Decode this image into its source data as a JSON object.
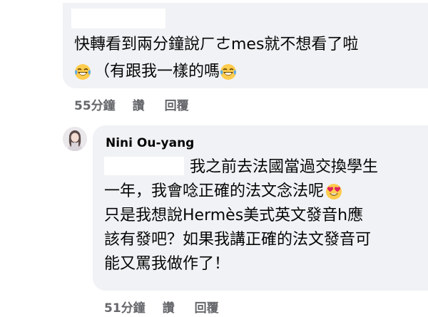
{
  "comment1": {
    "line1": "快轉看到兩分鐘說ㄏㄜmes就不想看了啦",
    "line2": "（有跟我一樣的嗎",
    "time": "55分鐘",
    "like_label": "讚",
    "reply_label": "回覆"
  },
  "comment2": {
    "author": "Nini Ou-yang",
    "line1": "我之前去法國當過交換學生",
    "line2": "一年，我會唸正確的法文念法呢",
    "line3": "只是我想說Hermès美式英文發音h應",
    "line4": "該有發吧？如果我講正確的法文發音可",
    "line5": "能又罵我做作了！",
    "time": "51分鐘",
    "like_label": "讚",
    "reply_label": "回覆"
  },
  "icons": {
    "laughing": "laughing-crying-emoji",
    "heart_eyes": "heart-eyes-emoji"
  }
}
